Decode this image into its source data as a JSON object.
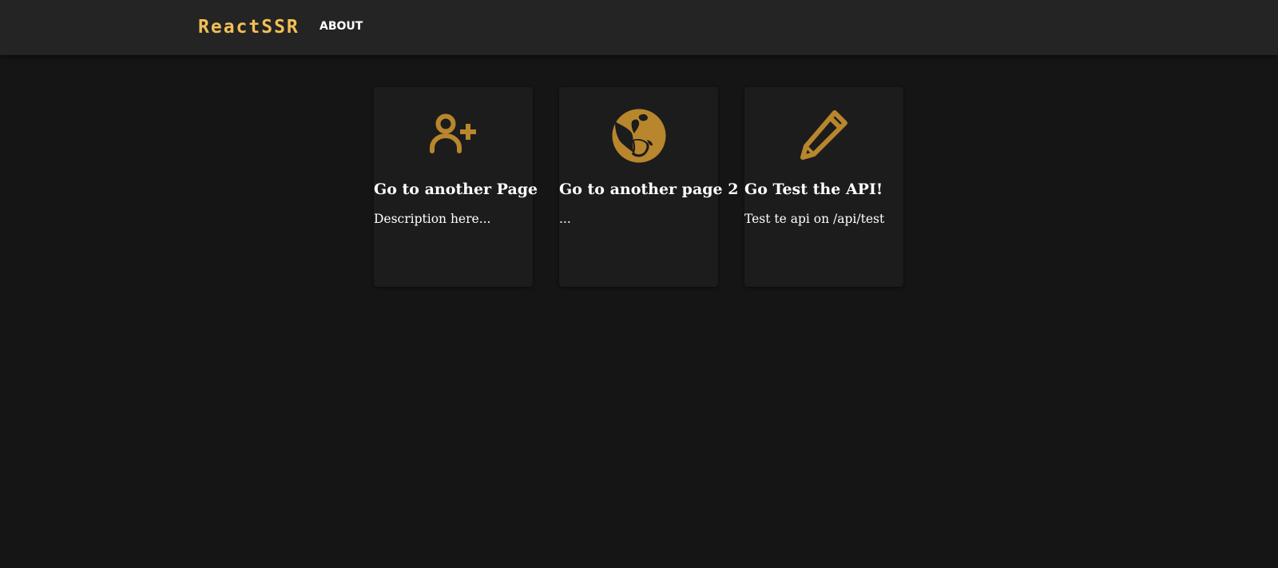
{
  "nav": {
    "brand": "ReactSSR",
    "links": [
      "ABOUT"
    ]
  },
  "cards": [
    {
      "icon": "person-add-icon",
      "title": "Go to another Page",
      "description": "Description here..."
    },
    {
      "icon": "globe-icon",
      "title": "Go to another page 2",
      "description": "..."
    },
    {
      "icon": "pencil-icon",
      "title": "Go Test the API!",
      "description": "Test te api on /api/test"
    }
  ],
  "colors": {
    "background": "#151515",
    "navbar": "#242424",
    "card": "#1c1c1c",
    "brand": "#f4bf56",
    "icon": "#b8862c",
    "text": "#ffffff"
  }
}
